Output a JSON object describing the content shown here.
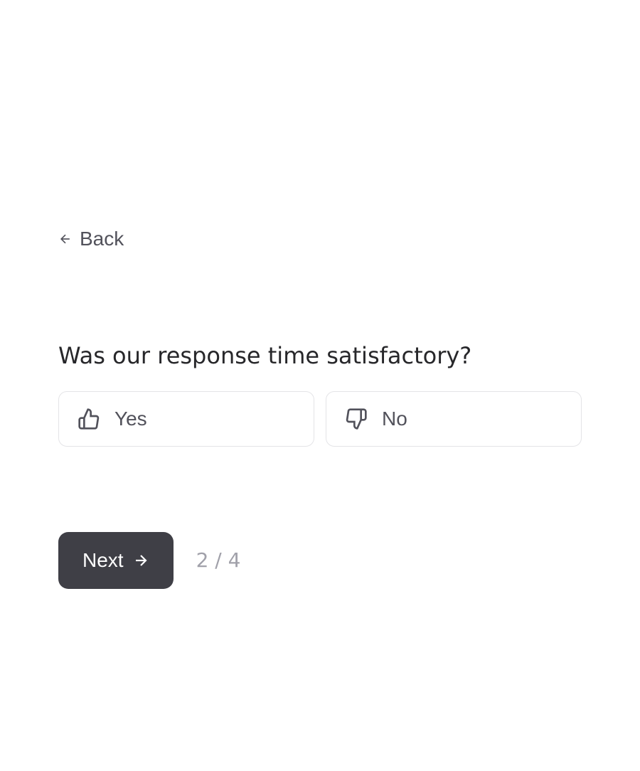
{
  "back": {
    "label": "Back"
  },
  "question": {
    "text": "Was our response time satisfactory?"
  },
  "options": {
    "yes": {
      "label": "Yes"
    },
    "no": {
      "label": "No"
    }
  },
  "next": {
    "label": "Next"
  },
  "pagination": {
    "current": 2,
    "total": 4,
    "display": "2 / 4"
  }
}
